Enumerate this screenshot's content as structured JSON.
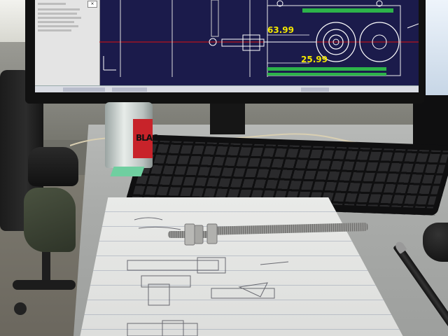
{
  "cad": {
    "dimension_top": "63.99",
    "dimension_bottom": "25.99",
    "text_color": "#f2e600",
    "background_color": "#1b1b4b"
  },
  "can": {
    "label_text": "BLAC"
  },
  "colors": {
    "can_label": "#c8232a",
    "sticky_note": "#6fcfa0"
  }
}
